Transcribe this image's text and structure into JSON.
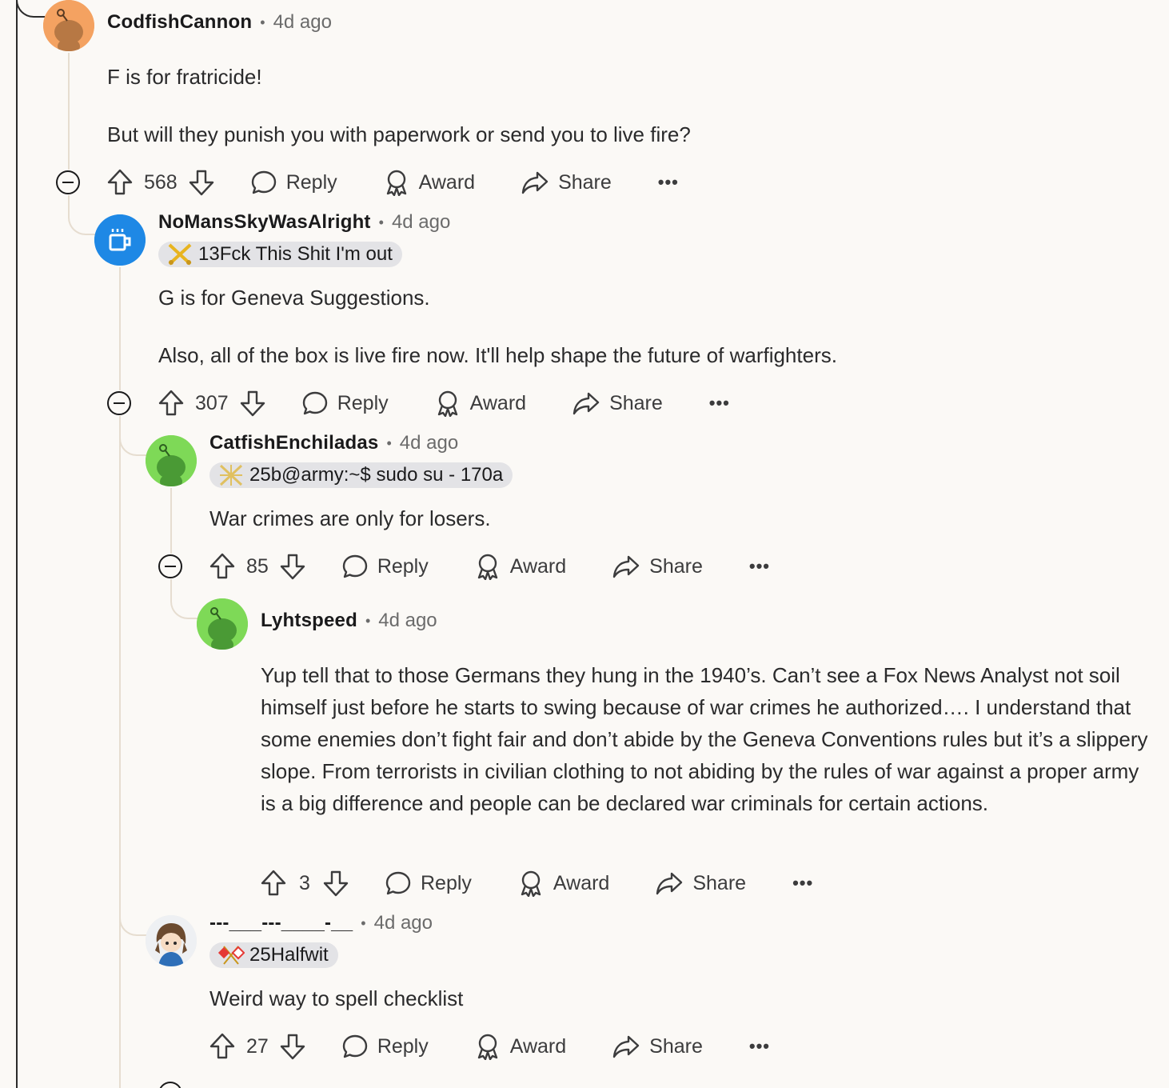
{
  "comments": [
    {
      "author": "CodfishCannon",
      "time": "4d ago",
      "paragraphs": [
        "F is for fratricide!",
        "But will they punish you with paperwork or send you to live fire?"
      ],
      "score": "568",
      "avatar_color": "#f4a261"
    },
    {
      "author": "NoMansSkyWasAlright",
      "time": "4d ago",
      "flair": "13Fck This Shit I'm out",
      "paragraphs": [
        "G is for Geneva Suggestions.",
        "Also, all of the box is live fire now. It'll help shape the future of warfighters."
      ],
      "score": "307",
      "avatar_color": "#1e88e5"
    },
    {
      "author": "CatfishEnchiladas",
      "time": "4d ago",
      "flair": "25b@army:~$ sudo su - 170a",
      "paragraphs": [
        "War crimes are only for losers."
      ],
      "score": "85",
      "avatar_color": "#7ed957"
    },
    {
      "author": "Lyhtspeed",
      "time": "4d ago",
      "paragraphs": [
        "Yup tell that to those Germans they hung in the 1940’s. Can’t see a Fox News Analyst not soil himself just before he starts to swing because of war crimes he authorized…. I understand that some enemies don’t fight fair and don’t abide by the Geneva Conventions rules but it’s a slippery slope. From terrorists in civilian clothing to not abiding by the rules of war against a proper army is a big difference and people can be declared war criminals for certain actions."
      ],
      "score": "3",
      "avatar_color": "#7ed957"
    },
    {
      "author": "---___---____-__",
      "time": "4d ago",
      "flair": "25Halfwit",
      "paragraphs": [
        "Weird way to spell checklist"
      ],
      "score": "27",
      "avatar_color": "#e8e8ea"
    }
  ],
  "labels": {
    "reply": "Reply",
    "award": "Award",
    "share": "Share",
    "more": "•••",
    "separator": "•"
  },
  "icons": {
    "upvote": "arrow-up-outline-icon",
    "downvote": "arrow-down-outline-icon",
    "reply": "speech-bubble-icon",
    "award": "award-ribbon-icon",
    "share": "share-arrow-icon",
    "collapse": "minus-circle-icon"
  }
}
